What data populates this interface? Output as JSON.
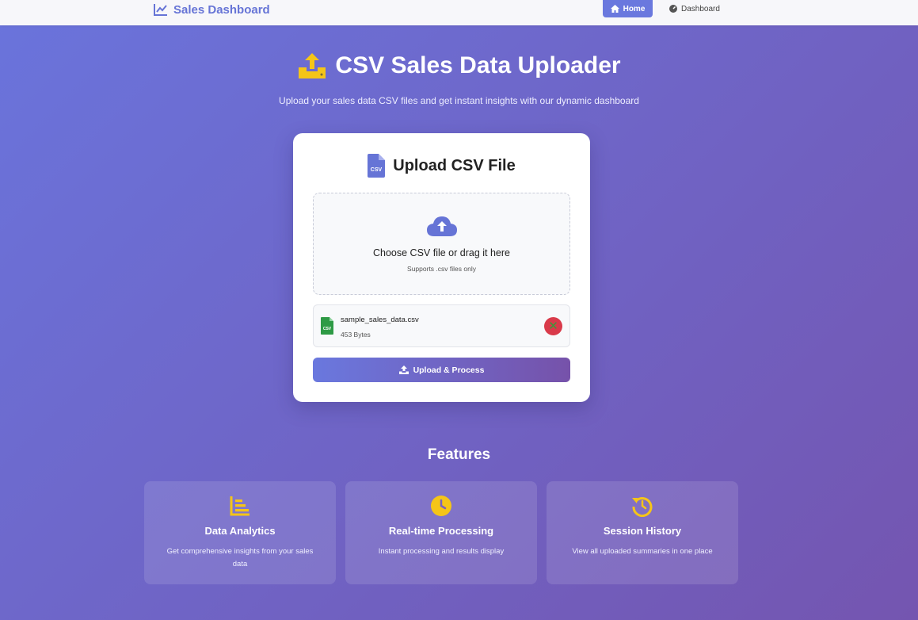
{
  "navbar": {
    "brand": "Sales Dashboard",
    "home_label": "Home",
    "dashboard_label": "Dashboard"
  },
  "hero": {
    "title": "CSV Sales Data Uploader",
    "subtitle": "Upload your sales data CSV files and get instant insights with our dynamic dashboard"
  },
  "upload_card": {
    "title": "Upload CSV File",
    "dropzone_text": "Choose CSV file or drag it here",
    "dropzone_hint": "Supports .csv files only",
    "selected_file": {
      "name": "sample_sales_data.csv",
      "size": "453 Bytes"
    },
    "upload_button": "Upload & Process"
  },
  "features": {
    "title": "Features",
    "items": [
      {
        "title": "Data Analytics",
        "description": "Get comprehensive insights from your sales data",
        "icon": "chart-bars-icon"
      },
      {
        "title": "Real-time Processing",
        "description": "Instant processing and results display",
        "icon": "clock-icon"
      },
      {
        "title": "Session History",
        "description": "View all uploaded summaries in one place",
        "icon": "history-icon"
      }
    ]
  },
  "colors": {
    "accent": "#6a78de",
    "icon_yellow": "#f5c518",
    "danger": "#d93a4a",
    "csv_green": "#2e9a45"
  }
}
